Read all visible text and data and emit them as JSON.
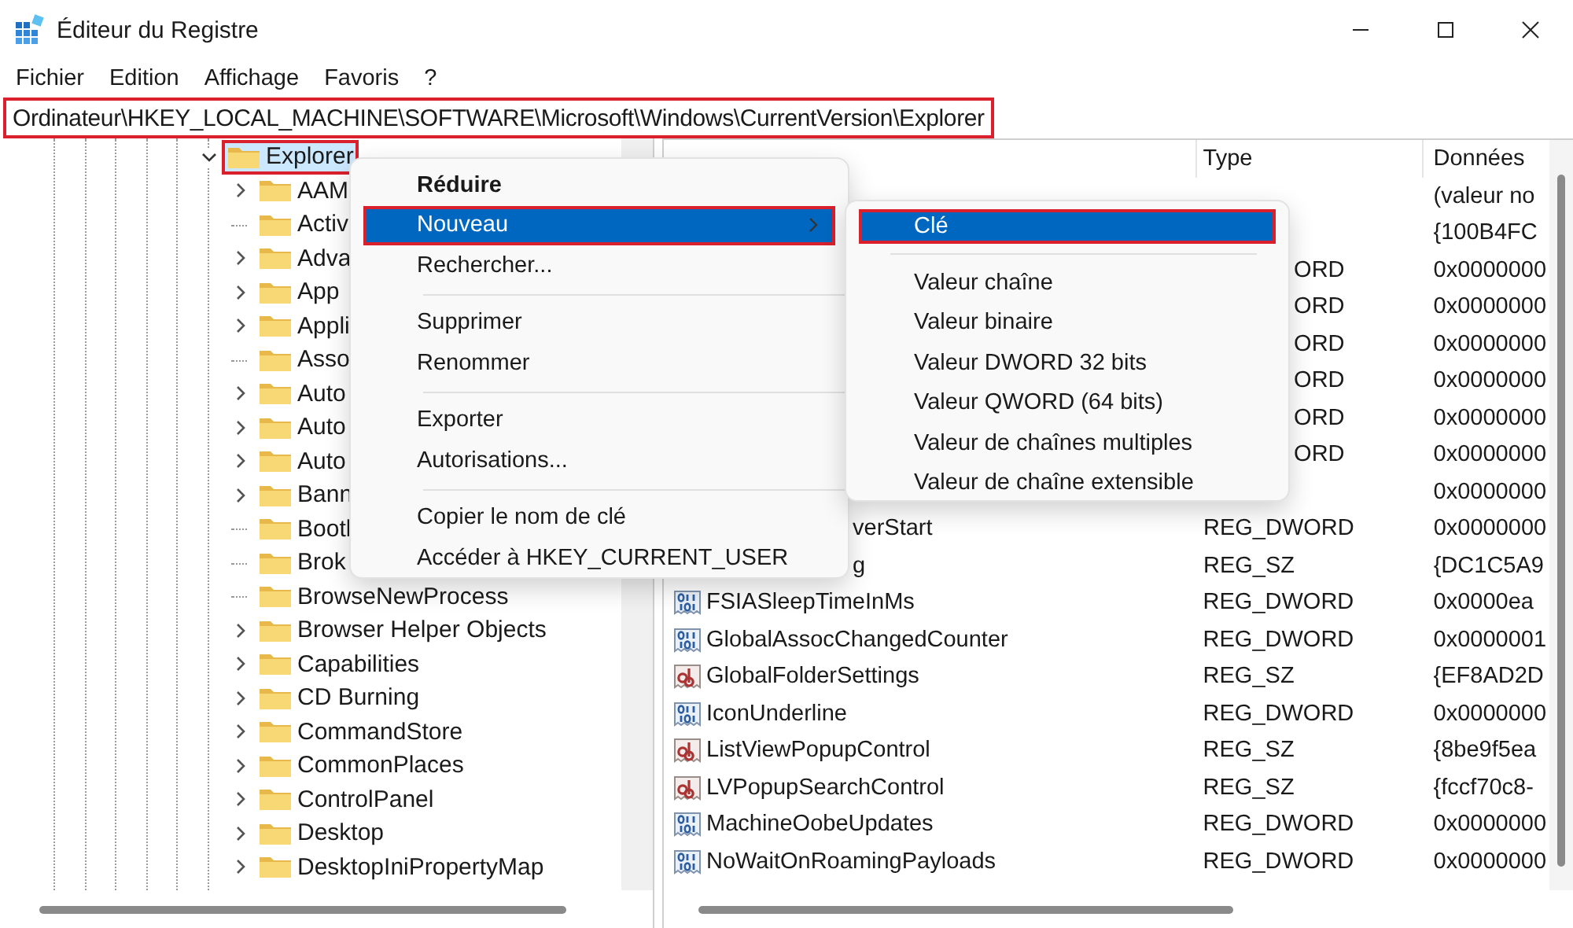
{
  "window": {
    "title": "Éditeur du Registre"
  },
  "menu_bar": [
    "Fichier",
    "Edition",
    "Affichage",
    "Favoris",
    "?"
  ],
  "address_bar": {
    "value": "Ordinateur\\HKEY_LOCAL_MACHINE\\SOFTWARE\\Microsoft\\Windows\\CurrentVersion\\Explorer",
    "highlighted": true
  },
  "tree": {
    "items": [
      {
        "label": "Explorer",
        "expanded": true,
        "selected": true,
        "highlighted": true,
        "children": [
          {
            "label": "AAM",
            "expandable": true
          },
          {
            "label": "Activ",
            "expandable": false
          },
          {
            "label": "Adva",
            "expandable": true
          },
          {
            "label": "App",
            "expandable": true
          },
          {
            "label": "Appli",
            "expandable": true
          },
          {
            "label": "Asso",
            "expandable": false
          },
          {
            "label": "Auto",
            "expandable": true
          },
          {
            "label": "Auto",
            "expandable": true
          },
          {
            "label": "Auto",
            "expandable": true
          },
          {
            "label": "Bann",
            "expandable": true
          },
          {
            "label": "Bootl",
            "expandable": false
          },
          {
            "label": "Brok",
            "expandable": false
          },
          {
            "label": "BrowseNewProcess",
            "expandable": false
          },
          {
            "label": "Browser Helper Objects",
            "expandable": true
          },
          {
            "label": "Capabilities",
            "expandable": true
          },
          {
            "label": "CD Burning",
            "expandable": true
          },
          {
            "label": "CommandStore",
            "expandable": true
          },
          {
            "label": "CommonPlaces",
            "expandable": true
          },
          {
            "label": "ControlPanel",
            "expandable": true
          },
          {
            "label": "Desktop",
            "expandable": true
          },
          {
            "label": "DesktopIniPropertyMap",
            "expandable": true
          }
        ]
      }
    ]
  },
  "list": {
    "columns": [
      "Type",
      "Données"
    ],
    "rows": [
      {
        "data": "(valeur no"
      },
      {
        "data": "{100B4FC"
      },
      {
        "type": "ORD",
        "type_cut": true,
        "data": "0x0000000"
      },
      {
        "type": "ORD",
        "type_cut": true,
        "data": "0x0000000"
      },
      {
        "type": "ORD",
        "type_cut": true,
        "data": "0x0000000"
      },
      {
        "type": "ORD",
        "type_cut": true,
        "data": "0x0000000"
      },
      {
        "type": "ORD",
        "type_cut": true,
        "data": "0x0000000"
      },
      {
        "type": "ORD",
        "type_cut": true,
        "data": "0x0000000"
      },
      {
        "data": "0x0000000"
      },
      {
        "name": "verStart",
        "name_cut": true,
        "type": "REG_DWORD",
        "data": "0x0000000"
      },
      {
        "name": "g",
        "name_cut": true,
        "type": "REG_SZ",
        "data": "{DC1C5A9"
      },
      {
        "kind": "binary",
        "name": "FSIASleepTimeInMs",
        "type": "REG_DWORD",
        "data": "0x0000ea"
      },
      {
        "kind": "binary",
        "name": "GlobalAssocChangedCounter",
        "type": "REG_DWORD",
        "data": "0x0000001"
      },
      {
        "kind": "string",
        "name": "GlobalFolderSettings",
        "type": "REG_SZ",
        "data": "{EF8AD2D"
      },
      {
        "kind": "binary",
        "name": "IconUnderline",
        "type": "REG_DWORD",
        "data": "0x0000000"
      },
      {
        "kind": "string",
        "name": "ListViewPopupControl",
        "type": "REG_SZ",
        "data": "{8be9f5ea"
      },
      {
        "kind": "string",
        "name": "LVPopupSearchControl",
        "type": "REG_SZ",
        "data": "{fccf70c8-"
      },
      {
        "kind": "binary",
        "name": "MachineOobeUpdates",
        "type": "REG_DWORD",
        "data": "0x0000000"
      },
      {
        "kind": "binary",
        "name": "NoWaitOnRoamingPayloads",
        "type": "REG_DWORD",
        "data": "0x0000000"
      }
    ]
  },
  "context_menu": {
    "items": [
      {
        "kind": "item",
        "label": "Réduire",
        "default": true,
        "selected": false,
        "highlighted": false,
        "submenu": false
      },
      {
        "kind": "item",
        "label": "Nouveau",
        "default": false,
        "selected": true,
        "highlighted": true,
        "submenu": true
      },
      {
        "kind": "item",
        "label": "Rechercher...",
        "default": false,
        "selected": false,
        "highlighted": false,
        "submenu": false
      },
      {
        "kind": "separator"
      },
      {
        "kind": "item",
        "label": "Supprimer",
        "default": false,
        "selected": false,
        "highlighted": false,
        "submenu": false
      },
      {
        "kind": "item",
        "label": "Renommer",
        "default": false,
        "selected": false,
        "highlighted": false,
        "submenu": false
      },
      {
        "kind": "separator"
      },
      {
        "kind": "item",
        "label": "Exporter",
        "default": false,
        "selected": false,
        "highlighted": false,
        "submenu": false
      },
      {
        "kind": "item",
        "label": "Autorisations...",
        "default": false,
        "selected": false,
        "highlighted": false,
        "submenu": false
      },
      {
        "kind": "separator"
      },
      {
        "kind": "item",
        "label": "Copier le nom de clé",
        "default": false,
        "selected": false,
        "highlighted": false,
        "submenu": false
      },
      {
        "kind": "item",
        "label": "Accéder à HKEY_CURRENT_USER",
        "default": false,
        "selected": false,
        "highlighted": false,
        "submenu": false
      }
    ]
  },
  "submenu": {
    "items": [
      {
        "kind": "item",
        "label": "Clé",
        "selected": true,
        "highlighted": true
      },
      {
        "kind": "separator"
      },
      {
        "kind": "item",
        "label": "Valeur chaîne",
        "selected": false,
        "highlighted": false
      },
      {
        "kind": "item",
        "label": "Valeur binaire",
        "selected": false,
        "highlighted": false
      },
      {
        "kind": "item",
        "label": "Valeur DWORD 32 bits",
        "selected": false,
        "highlighted": false
      },
      {
        "kind": "item",
        "label": "Valeur QWORD (64 bits)",
        "selected": false,
        "highlighted": false
      },
      {
        "kind": "item",
        "label": "Valeur de chaînes multiples",
        "selected": false,
        "highlighted": false
      },
      {
        "kind": "item",
        "label": "Valeur de chaîne extensible",
        "selected": false,
        "highlighted": false
      }
    ]
  }
}
